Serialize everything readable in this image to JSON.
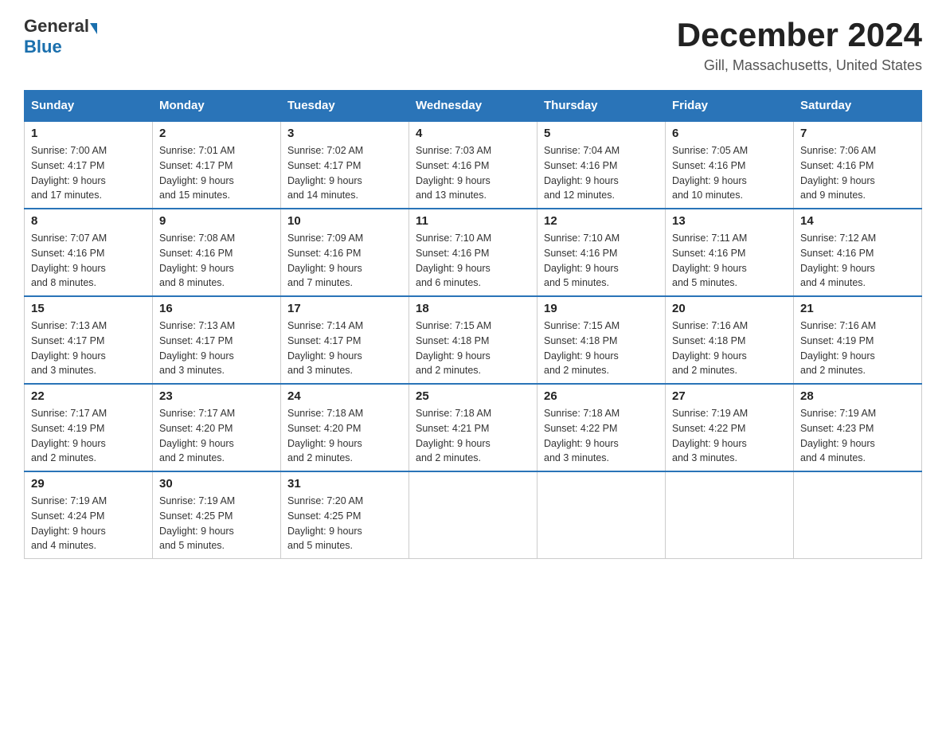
{
  "logo": {
    "general": "General",
    "blue": "Blue"
  },
  "title": "December 2024",
  "location": "Gill, Massachusetts, United States",
  "days_of_week": [
    "Sunday",
    "Monday",
    "Tuesday",
    "Wednesday",
    "Thursday",
    "Friday",
    "Saturday"
  ],
  "weeks": [
    [
      {
        "day": "1",
        "sunrise": "7:00 AM",
        "sunset": "4:17 PM",
        "daylight": "9 hours and 17 minutes."
      },
      {
        "day": "2",
        "sunrise": "7:01 AM",
        "sunset": "4:17 PM",
        "daylight": "9 hours and 15 minutes."
      },
      {
        "day": "3",
        "sunrise": "7:02 AM",
        "sunset": "4:17 PM",
        "daylight": "9 hours and 14 minutes."
      },
      {
        "day": "4",
        "sunrise": "7:03 AM",
        "sunset": "4:16 PM",
        "daylight": "9 hours and 13 minutes."
      },
      {
        "day": "5",
        "sunrise": "7:04 AM",
        "sunset": "4:16 PM",
        "daylight": "9 hours and 12 minutes."
      },
      {
        "day": "6",
        "sunrise": "7:05 AM",
        "sunset": "4:16 PM",
        "daylight": "9 hours and 10 minutes."
      },
      {
        "day": "7",
        "sunrise": "7:06 AM",
        "sunset": "4:16 PM",
        "daylight": "9 hours and 9 minutes."
      }
    ],
    [
      {
        "day": "8",
        "sunrise": "7:07 AM",
        "sunset": "4:16 PM",
        "daylight": "9 hours and 8 minutes."
      },
      {
        "day": "9",
        "sunrise": "7:08 AM",
        "sunset": "4:16 PM",
        "daylight": "9 hours and 8 minutes."
      },
      {
        "day": "10",
        "sunrise": "7:09 AM",
        "sunset": "4:16 PM",
        "daylight": "9 hours and 7 minutes."
      },
      {
        "day": "11",
        "sunrise": "7:10 AM",
        "sunset": "4:16 PM",
        "daylight": "9 hours and 6 minutes."
      },
      {
        "day": "12",
        "sunrise": "7:10 AM",
        "sunset": "4:16 PM",
        "daylight": "9 hours and 5 minutes."
      },
      {
        "day": "13",
        "sunrise": "7:11 AM",
        "sunset": "4:16 PM",
        "daylight": "9 hours and 5 minutes."
      },
      {
        "day": "14",
        "sunrise": "7:12 AM",
        "sunset": "4:16 PM",
        "daylight": "9 hours and 4 minutes."
      }
    ],
    [
      {
        "day": "15",
        "sunrise": "7:13 AM",
        "sunset": "4:17 PM",
        "daylight": "9 hours and 3 minutes."
      },
      {
        "day": "16",
        "sunrise": "7:13 AM",
        "sunset": "4:17 PM",
        "daylight": "9 hours and 3 minutes."
      },
      {
        "day": "17",
        "sunrise": "7:14 AM",
        "sunset": "4:17 PM",
        "daylight": "9 hours and 3 minutes."
      },
      {
        "day": "18",
        "sunrise": "7:15 AM",
        "sunset": "4:18 PM",
        "daylight": "9 hours and 2 minutes."
      },
      {
        "day": "19",
        "sunrise": "7:15 AM",
        "sunset": "4:18 PM",
        "daylight": "9 hours and 2 minutes."
      },
      {
        "day": "20",
        "sunrise": "7:16 AM",
        "sunset": "4:18 PM",
        "daylight": "9 hours and 2 minutes."
      },
      {
        "day": "21",
        "sunrise": "7:16 AM",
        "sunset": "4:19 PM",
        "daylight": "9 hours and 2 minutes."
      }
    ],
    [
      {
        "day": "22",
        "sunrise": "7:17 AM",
        "sunset": "4:19 PM",
        "daylight": "9 hours and 2 minutes."
      },
      {
        "day": "23",
        "sunrise": "7:17 AM",
        "sunset": "4:20 PM",
        "daylight": "9 hours and 2 minutes."
      },
      {
        "day": "24",
        "sunrise": "7:18 AM",
        "sunset": "4:20 PM",
        "daylight": "9 hours and 2 minutes."
      },
      {
        "day": "25",
        "sunrise": "7:18 AM",
        "sunset": "4:21 PM",
        "daylight": "9 hours and 2 minutes."
      },
      {
        "day": "26",
        "sunrise": "7:18 AM",
        "sunset": "4:22 PM",
        "daylight": "9 hours and 3 minutes."
      },
      {
        "day": "27",
        "sunrise": "7:19 AM",
        "sunset": "4:22 PM",
        "daylight": "9 hours and 3 minutes."
      },
      {
        "day": "28",
        "sunrise": "7:19 AM",
        "sunset": "4:23 PM",
        "daylight": "9 hours and 4 minutes."
      }
    ],
    [
      {
        "day": "29",
        "sunrise": "7:19 AM",
        "sunset": "4:24 PM",
        "daylight": "9 hours and 4 minutes."
      },
      {
        "day": "30",
        "sunrise": "7:19 AM",
        "sunset": "4:25 PM",
        "daylight": "9 hours and 5 minutes."
      },
      {
        "day": "31",
        "sunrise": "7:20 AM",
        "sunset": "4:25 PM",
        "daylight": "9 hours and 5 minutes."
      },
      null,
      null,
      null,
      null
    ]
  ],
  "labels": {
    "sunrise": "Sunrise:",
    "sunset": "Sunset:",
    "daylight": "Daylight:"
  }
}
